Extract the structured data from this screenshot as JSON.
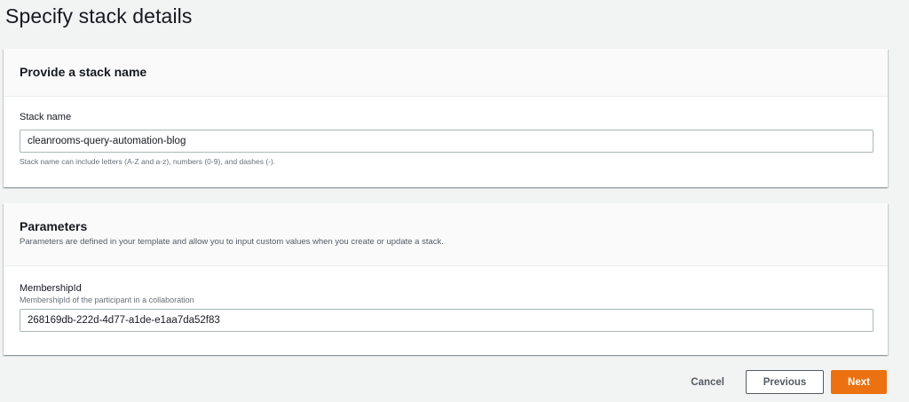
{
  "page": {
    "title": "Specify stack details"
  },
  "stack_name_section": {
    "heading": "Provide a stack name",
    "field_label": "Stack name",
    "field_value": "cleanrooms-query-automation-blog",
    "hint": "Stack name can include letters (A-Z and a-z), numbers (0-9), and dashes (-)."
  },
  "parameters_section": {
    "heading": "Parameters",
    "description": "Parameters are defined in your template and allow you to input custom values when you create or update a stack.",
    "params": [
      {
        "label": "MembershipId",
        "description": "MembershipId of the participant in a collaboration",
        "value": "268169db-222d-4d77-a1de-e1aa7da52f83"
      }
    ]
  },
  "actions": {
    "cancel_label": "Cancel",
    "previous_label": "Previous",
    "next_label": "Next"
  },
  "colors": {
    "primary_button": "#ec7211",
    "background": "#f2f3f3"
  }
}
